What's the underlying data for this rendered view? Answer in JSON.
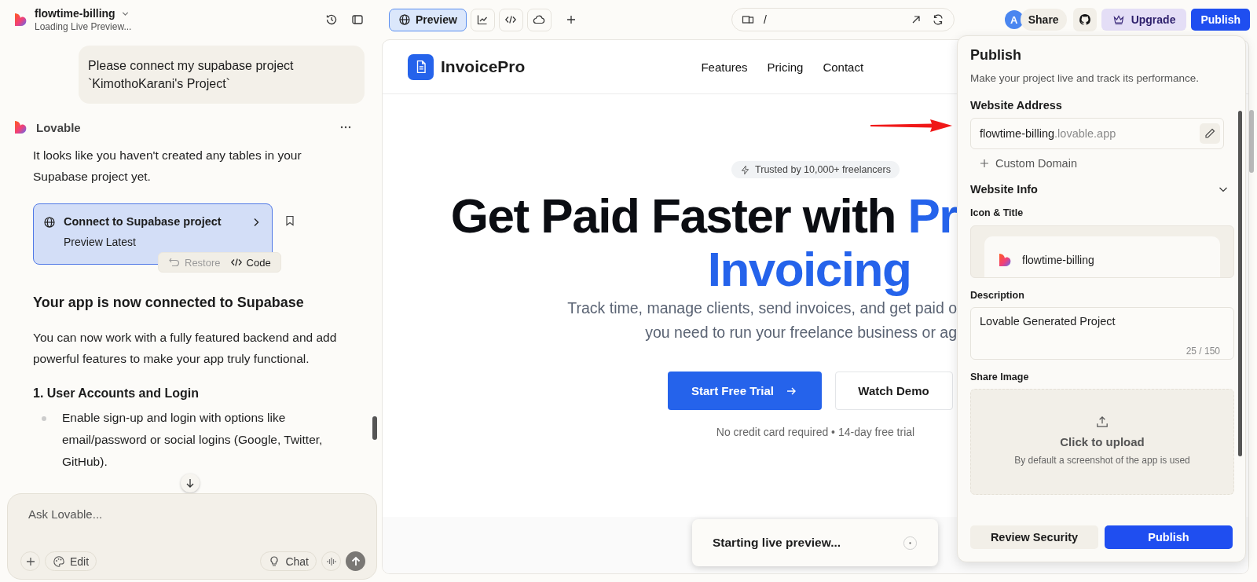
{
  "project": {
    "name": "flowtime-billing",
    "status": "Loading Live Preview..."
  },
  "view_tabs": [
    {
      "kind": "preview",
      "label": "Preview",
      "selected": true
    },
    {
      "kind": "analytics",
      "selected": false
    },
    {
      "kind": "code",
      "selected": false
    },
    {
      "kind": "cloud",
      "selected": false
    }
  ],
  "url_bar": {
    "path": "/"
  },
  "header_actions": {
    "avatar": "A",
    "share": "Share",
    "upgrade": "Upgrade",
    "publish": "Publish"
  },
  "chat": {
    "user_message": "Please connect my supabase project `KimothoKarani's Project`",
    "assistant": "Lovable",
    "intro": "It looks like you haven't created any tables in your Supabase project yet.",
    "action_card": {
      "title": "Connect to Supabase project",
      "subtitle": "Preview Latest"
    },
    "restore": {
      "label": "Restore",
      "disabled": true
    },
    "code": "Code",
    "heading": "Your app is now connected to Supabase",
    "paragraph": "You can now work with a fully featured backend and add powerful features to make your app truly functional.",
    "subheading": "1. User Accounts and Login",
    "bullets": [
      "Enable sign-up and login with options like email/password or social logins (Google, Twitter, GitHub)."
    ]
  },
  "composer": {
    "placeholder": "Ask Lovable...",
    "edit": "Edit",
    "chat": "Chat"
  },
  "site": {
    "brand": "InvoicePro",
    "nav": [
      "Features",
      "Pricing",
      "Contact"
    ],
    "badge": "Trusted by 10,000+ freelancers",
    "headline": "Get Paid Faster with ",
    "headline_accent": "Pr",
    "headline_line_2": "Invoicing",
    "subtitle": [
      "Track time, manage clients, send invoices, and get paid o",
      "you need to run your freelance business or ag"
    ],
    "primary_cta": "Start Free Trial",
    "secondary_cta": "Watch Demo",
    "note": "No credit card required • 14-day free trial"
  },
  "toast": "Starting live preview...",
  "publish_panel": {
    "title": "Publish",
    "description": "Make your project live and track its performance.",
    "address_label": "Website Address",
    "subdomain": "flowtime-billing",
    "domain_suffix": ".lovable.app",
    "custom_domain": "Custom Domain",
    "info_label": "Website Info",
    "info_expanded": true,
    "icon_title_label": "Icon & Title",
    "site_title": "flowtime-billing",
    "description_label": "Description",
    "description_value": "Lovable Generated Project",
    "counter": "25 / 150",
    "share_image_label": "Share Image",
    "upload": "Click to upload",
    "upload_hint": "By default a screenshot of the app is used",
    "review": "Review Security",
    "publish": "Publish"
  }
}
